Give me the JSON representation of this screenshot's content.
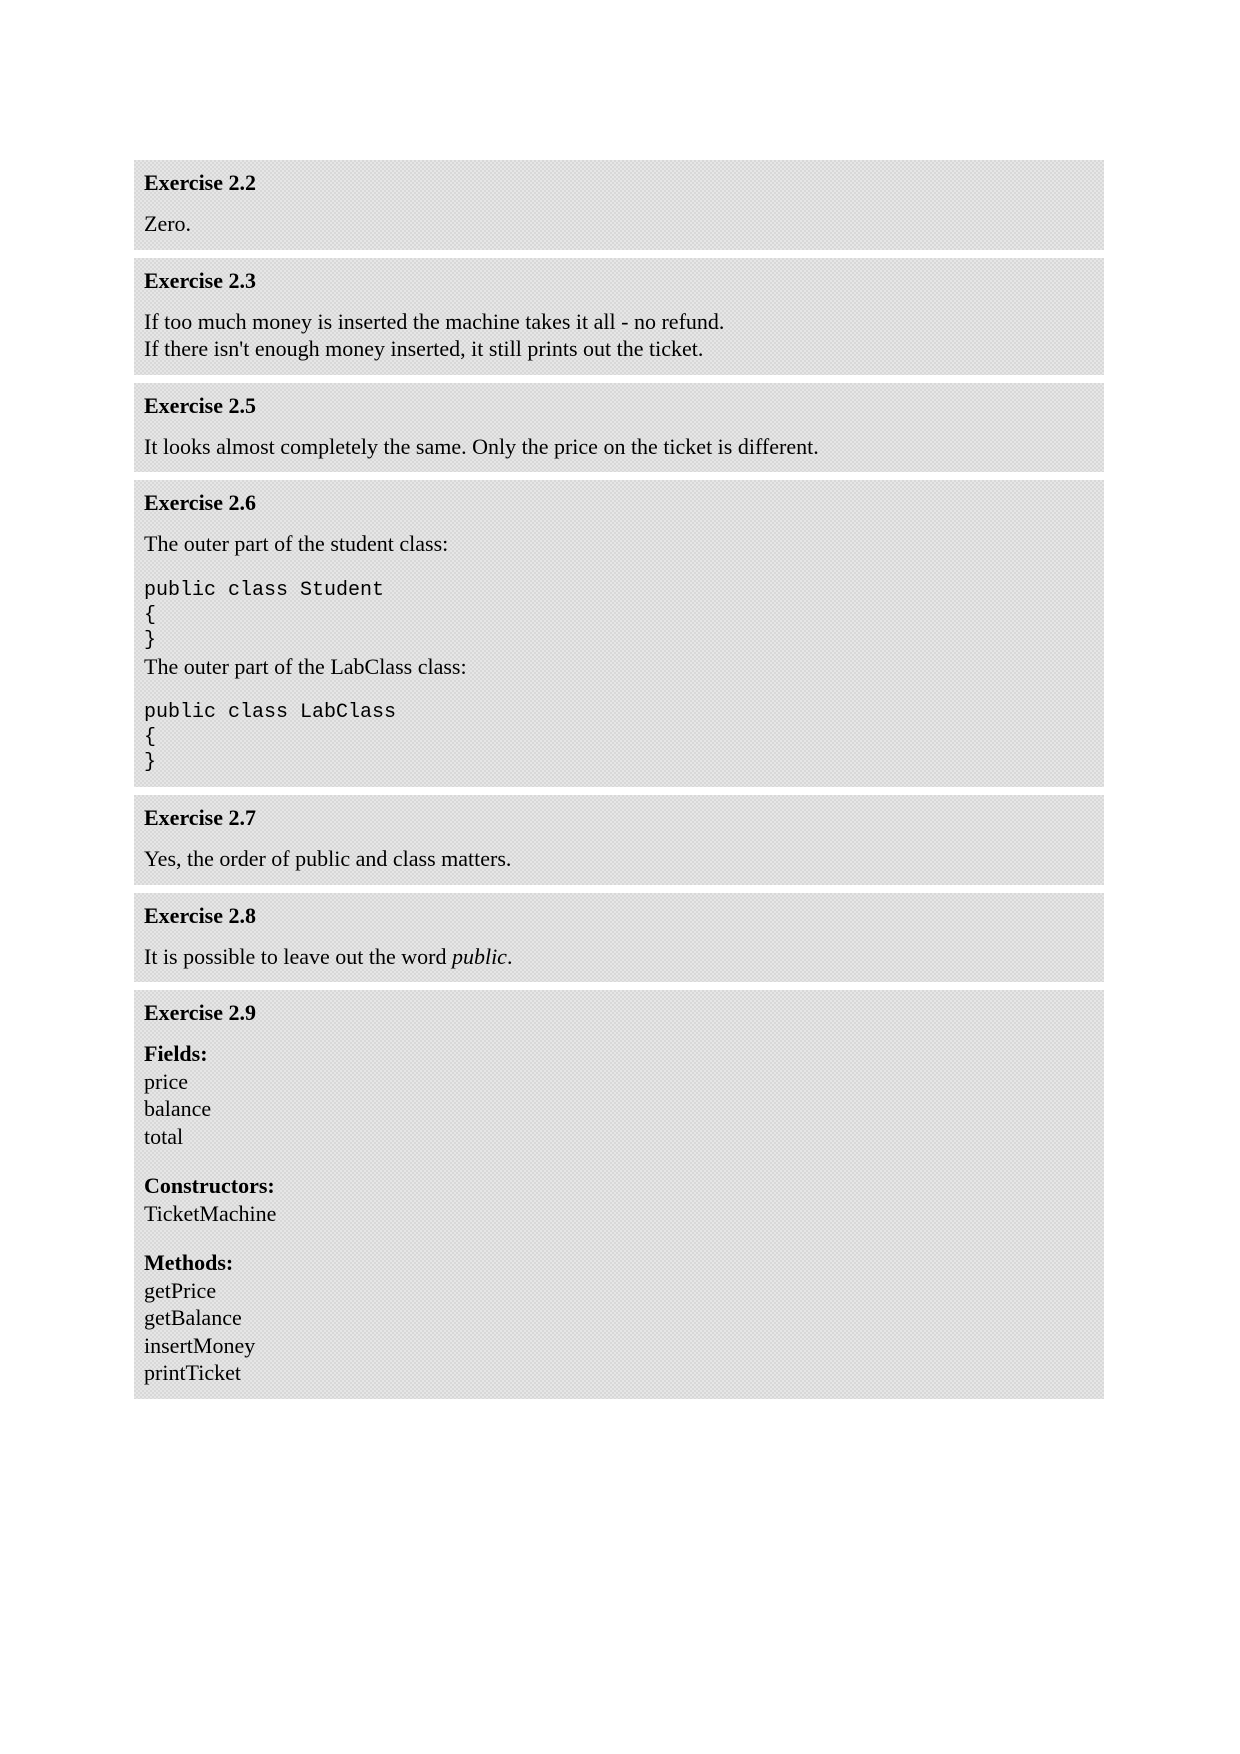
{
  "exercises": [
    {
      "title": "Exercise 2.2",
      "answer_lines": [
        "Zero."
      ]
    },
    {
      "title": "Exercise 2.3",
      "answer_lines": [
        "If too much money is inserted the machine takes it all - no refund.",
        "If there isn't enough money inserted, it still prints out the ticket."
      ]
    },
    {
      "title": "Exercise 2.5",
      "answer_lines": [
        "It looks almost completely the same. Only the price on the ticket is different."
      ]
    },
    {
      "title": "Exercise 2.6",
      "para1": "The outer part of the student class:",
      "code1": "public class Student\n{\n}",
      "para2": "The outer part of the LabClass class:",
      "code2": "public class LabClass\n{\n}"
    },
    {
      "title": "Exercise 2.7",
      "answer_lines": [
        "Yes, the order of public and class matters."
      ]
    },
    {
      "title": "Exercise 2.8",
      "answer_pre": "It is possible to leave out the word ",
      "answer_italic": "public",
      "answer_post": "."
    },
    {
      "title": "Exercise 2.9",
      "fields_label": "Fields:",
      "fields": [
        "price",
        "balance",
        "total"
      ],
      "constructors_label": "Constructors:",
      "constructors": [
        "TicketMachine"
      ],
      "methods_label": "Methods:",
      "methods": [
        "getPrice",
        "getBalance",
        "insertMoney",
        "printTicket"
      ]
    }
  ]
}
